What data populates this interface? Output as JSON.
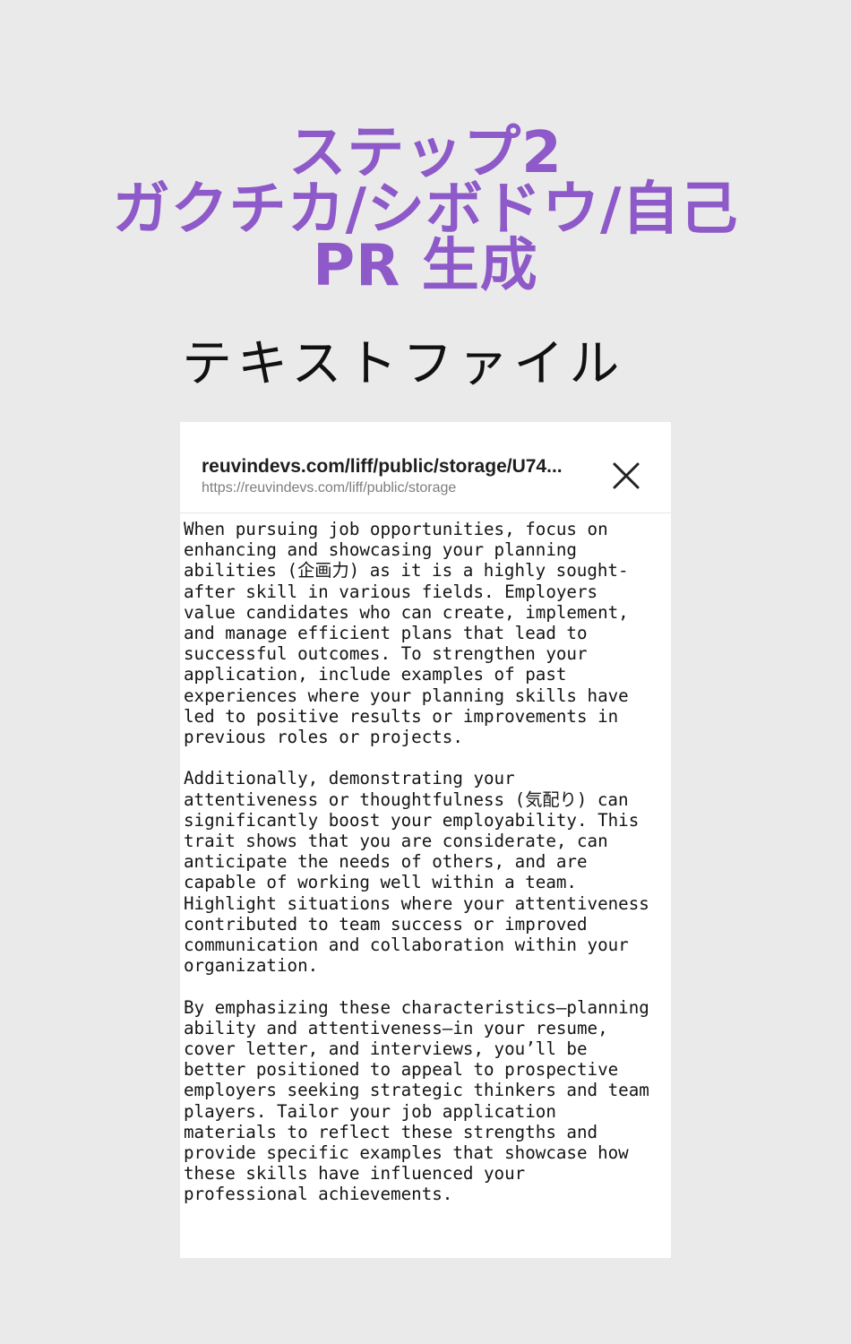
{
  "header": {
    "title_line1": "ステップ2",
    "title_line2": "ガクチカ/シボドウ/自己",
    "title_line3": "PR 生成",
    "subtitle": "テキストファイル"
  },
  "viewer": {
    "url_title": "reuvindevs.com/liff/public/storage/U74...",
    "url_sub": "https://reuvindevs.com/liff/public/storage",
    "close_icon": "close-icon",
    "paragraphs": [
      [
        "When pursuing job opportunities, focus on",
        "enhancing and showcasing your planning",
        "abilities (企画力) as it is a highly sought-",
        "after skill in various fields. Employers",
        "value candidates who can create, implement,",
        "and manage efficient plans that lead to",
        "successful outcomes. To strengthen your",
        "application, include examples of past",
        "experiences where your planning skills have",
        "led to positive results or improvements in",
        "previous roles or projects."
      ],
      [
        "Additionally, demonstrating your",
        "attentiveness or thoughtfulness (気配り) can",
        "significantly boost your employability. This",
        "trait shows that you are considerate, can",
        "anticipate the needs of others, and are",
        "capable of working well within a team.",
        "Highlight situations where your attentiveness",
        "contributed to team success or improved",
        "communication and collaboration within your",
        "organization."
      ],
      [
        "By emphasizing these characteristics—planning",
        "ability and attentiveness—in your resume,",
        "cover letter, and interviews, you’ll be",
        "better positioned to appeal to prospective",
        "employers seeking strategic thinkers and team",
        "players. Tailor your job application",
        "materials to reflect these strengths and",
        "provide specific examples that showcase how",
        "these skills have influenced your",
        "professional achievements."
      ]
    ]
  }
}
